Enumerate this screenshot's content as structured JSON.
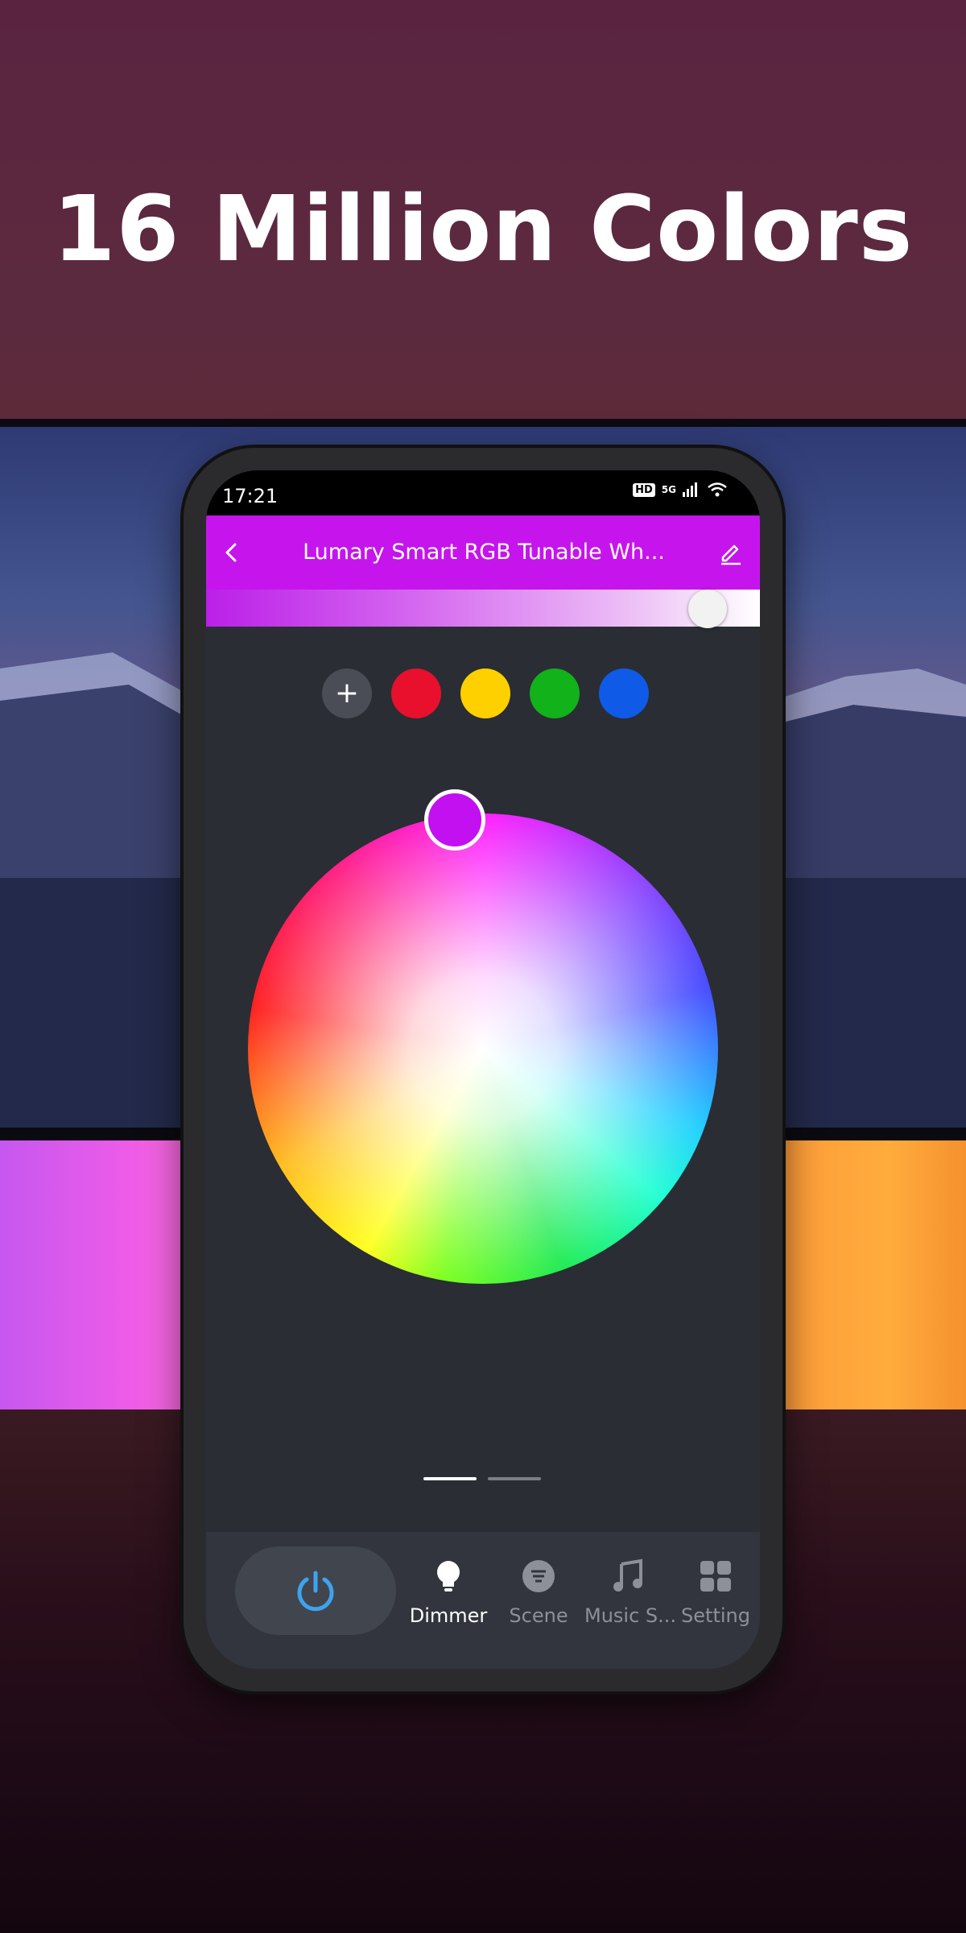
{
  "headline": "16 Million Colors",
  "status_bar": {
    "time": "17:21",
    "hd": "HD",
    "network": "5G"
  },
  "app_bar": {
    "title": "Lumary Smart RGB Tunable Wh...",
    "back_icon": "chevron-left-icon",
    "edit_icon": "pencil-icon",
    "color": "#c515ec"
  },
  "brightness": {
    "level": 0.95
  },
  "presets": [
    {
      "name": "add",
      "label": "+",
      "color": "#4a4d55"
    },
    {
      "name": "red",
      "color": "#e8102c"
    },
    {
      "name": "yellow",
      "color": "#ffd000"
    },
    {
      "name": "green",
      "color": "#12b21a"
    },
    {
      "name": "blue",
      "color": "#0f5be8"
    }
  ],
  "color_wheel": {
    "selected_color": "#c210f0"
  },
  "pager": {
    "pages": 2,
    "current": 1
  },
  "bottom_nav": {
    "power_icon": "power-icon",
    "power_color": "#3ea3ee",
    "items": [
      {
        "label": "Dimmer",
        "icon": "bulb-icon",
        "active": true
      },
      {
        "label": "Scene",
        "icon": "scene-icon",
        "active": false
      },
      {
        "label": "Music S...",
        "icon": "music-note-icon",
        "active": false
      },
      {
        "label": "Setting",
        "icon": "grid-icon",
        "active": false
      }
    ]
  }
}
